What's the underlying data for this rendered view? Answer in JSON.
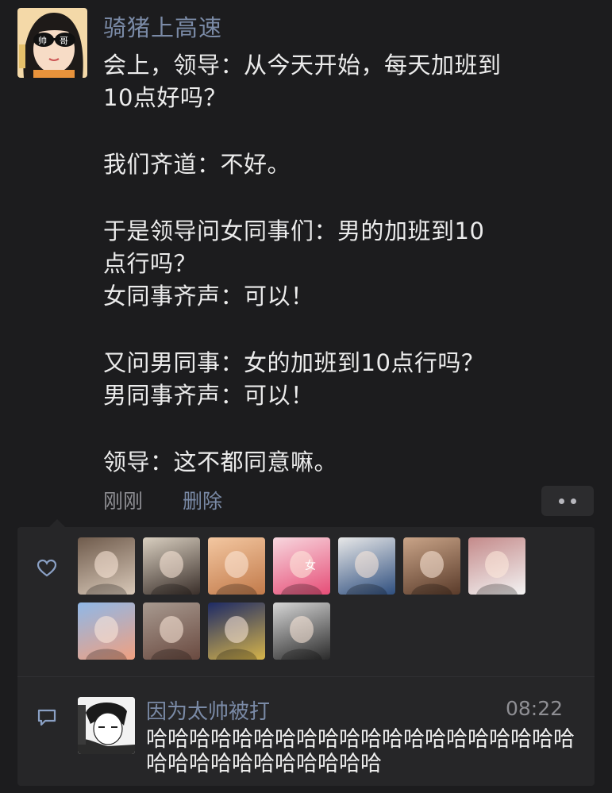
{
  "post": {
    "author": "骑猪上高速",
    "avatar_icon": "cartoon-girl-sunglasses-avatar",
    "avatar_glasses_text": [
      "帅",
      "哥"
    ],
    "lines": [
      "会上，领导：从今天开始，每天加班到",
      "10点好吗？",
      "",
      "我们齐道：不好。",
      "",
      "于是领导问女同事们：男的加班到10",
      "点行吗？",
      "女同事齐声：可以！",
      "",
      "又问男同事：女的加班到10点行吗？",
      "男同事齐声：可以！",
      "",
      "领导：这不都同意嘛。"
    ],
    "time": "刚刚",
    "delete_label": "删除"
  },
  "likes": {
    "icon": "heart-outline-icon",
    "avatars": [
      {
        "name": "blurry-pet-avatar",
        "colors": [
          "#6f5b4c",
          "#d8c8b8"
        ]
      },
      {
        "name": "girl-eating-avatar",
        "colors": [
          "#d9cfc0",
          "#3a2f2a"
        ]
      },
      {
        "name": "anime-girl-bear-avatar",
        "colors": [
          "#f3c7a1",
          "#c27a4a"
        ]
      },
      {
        "name": "cartoon-girl-glasses-avatar",
        "colors": [
          "#f7d7de",
          "#e64d77"
        ],
        "text": "女"
      },
      {
        "name": "cartoon-sailor-hat-avatar",
        "colors": [
          "#e8e8e8",
          "#2f4f7f"
        ]
      },
      {
        "name": "girl-hat-photo-avatar",
        "colors": [
          "#c9a488",
          "#5a3b2a"
        ]
      },
      {
        "name": "white-cat-avatar",
        "colors": [
          "#c48a8a",
          "#f3f3f3"
        ]
      },
      {
        "name": "anime-boy-avatar",
        "colors": [
          "#8fb8e8",
          "#f0a080"
        ]
      },
      {
        "name": "food-table-avatar",
        "colors": [
          "#a89a90",
          "#6a4a40"
        ]
      },
      {
        "name": "night-sky-avatar",
        "colors": [
          "#1d2a66",
          "#d6b44a"
        ]
      },
      {
        "name": "couple-photo-avatar",
        "colors": [
          "#d6d6d6",
          "#2a2a2a"
        ]
      }
    ]
  },
  "comment": {
    "icon": "comment-bubble-icon",
    "author": "因为太帅被打",
    "avatar_icon": "manga-boy-avatar",
    "time": "08:22",
    "text": "哈哈哈哈哈哈哈哈哈哈哈哈哈哈哈哈哈哈哈哈哈哈哈哈哈哈哈哈哈哈哈"
  },
  "colors": {
    "background": "#1c1c1e",
    "panel": "#262628",
    "name_link": "#7a8aa6",
    "text": "#ececec",
    "secondary": "#8e8e93"
  }
}
